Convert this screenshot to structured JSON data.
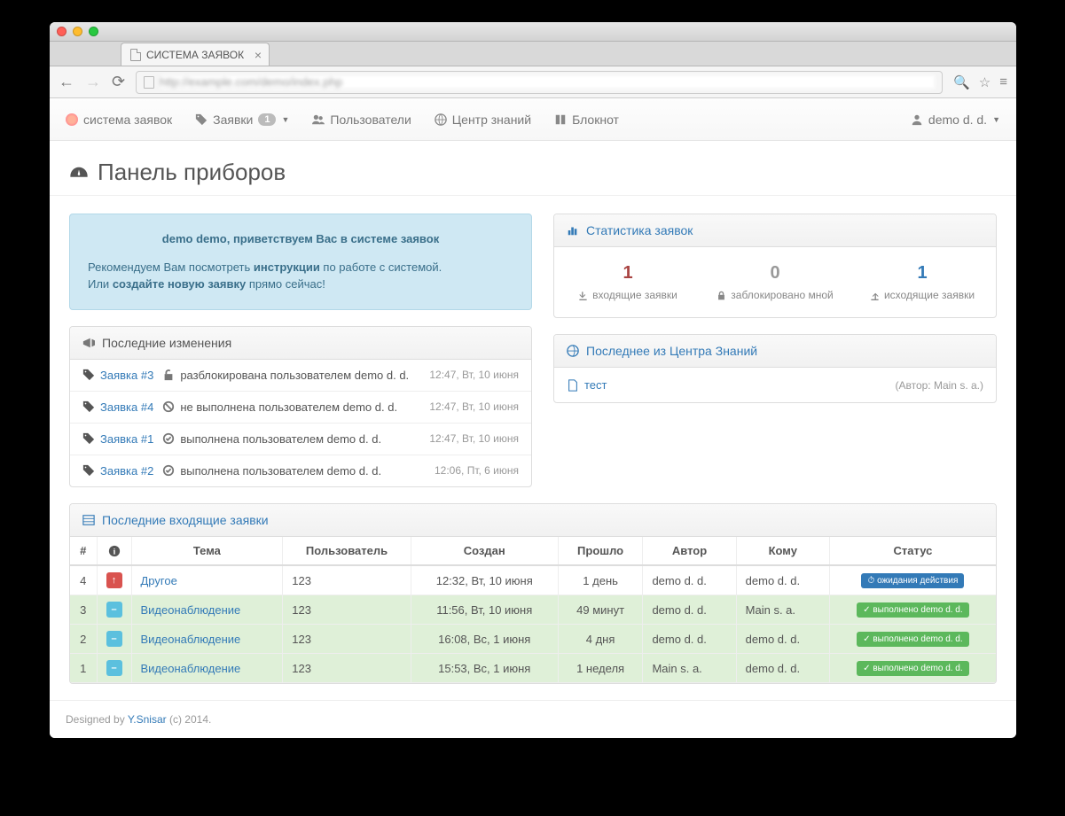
{
  "browser": {
    "tab_title": "СИСТЕМА ЗАЯВОК",
    "url": "http://example.com/demo/index.php"
  },
  "nav": {
    "brand": "система заявок",
    "tickets": "Заявки",
    "tickets_badge": "1",
    "users": "Пользователи",
    "knowledge": "Центр знаний",
    "notepad": "Блокнот",
    "user": "demo d. d."
  },
  "page_title": "Панель приборов",
  "welcome": {
    "title": "demo demo, приветствуем Вас в системе заявок",
    "line1a": "Рекомендуем Вам посмотреть ",
    "line1b": "инструкции",
    "line1c": " по работе   с системой.",
    "line2a": "Или ",
    "line2b": "создайте новую заявку",
    "line2c": " прямо сейчас!"
  },
  "stats": {
    "title": "Статистика заявок",
    "in_num": "1",
    "in_label": "входящие заявки",
    "lock_num": "0",
    "lock_label": "заблокировано мной",
    "out_num": "1",
    "out_label": "исходящие заявки"
  },
  "changes": {
    "title": "Последние изменения",
    "items": [
      {
        "link": "Заявка #3",
        "text": "разблокирована пользователем demo d. d.",
        "ts": "12:47, Вт, 10 июня",
        "icon": "unlock"
      },
      {
        "link": "Заявка #4",
        "text": "не выполнена пользователем demo d. d.",
        "ts": "12:47, Вт, 10 июня",
        "icon": "ban"
      },
      {
        "link": "Заявка #1",
        "text": "выполнена пользователем demo d. d.",
        "ts": "12:47, Вт, 10 июня",
        "icon": "check"
      },
      {
        "link": "Заявка #2",
        "text": "выполнена пользователем demo d. d.",
        "ts": "12:06, Пт, 6 июня",
        "icon": "check"
      }
    ]
  },
  "knowledge": {
    "title": "Последнее из Центра Знаний",
    "item": "тест",
    "meta": "(Автор: Main s. a.)"
  },
  "inbox": {
    "title": "Последние входящие заявки",
    "headers": {
      "num": "#",
      "info": "",
      "theme": "Тема",
      "user": "Пользователь",
      "created": "Создан",
      "elapsed": "Прошло",
      "author": "Автор",
      "to": "Кому",
      "status": "Статус"
    },
    "rows": [
      {
        "num": "4",
        "prio": "up",
        "theme": "Другое",
        "user": "123",
        "created": "12:32, Вт, 10 июня",
        "elapsed": "1 день",
        "author": "demo d. d.",
        "to": "demo d. d.",
        "status": "ожидания действия",
        "status_cls": "wait",
        "row": "plain"
      },
      {
        "num": "3",
        "prio": "eq",
        "theme": "Видеонаблюдение",
        "user": "123",
        "created": "11:56, Вт, 10 июня",
        "elapsed": "49 минут",
        "author": "demo d. d.",
        "to": "Main s. a.",
        "status": "выполнено demo d. d.",
        "status_cls": "done",
        "row": "green"
      },
      {
        "num": "2",
        "prio": "eq",
        "theme": "Видеонаблюдение",
        "user": "123",
        "created": "16:08, Вс, 1 июня",
        "elapsed": "4 дня",
        "author": "demo d. d.",
        "to": "demo d. d.",
        "status": "выполнено demo d. d.",
        "status_cls": "done",
        "row": "green"
      },
      {
        "num": "1",
        "prio": "eq",
        "theme": "Видеонаблюдение",
        "user": "123",
        "created": "15:53, Вс, 1 июня",
        "elapsed": "1 неделя",
        "author": "Main s. a.",
        "to": "demo d. d.",
        "status": "выполнено demo d. d.",
        "status_cls": "done",
        "row": "green"
      }
    ]
  },
  "footer": {
    "a": "Designed by ",
    "link": "Y.Snisar",
    "b": " (c) 2014."
  }
}
